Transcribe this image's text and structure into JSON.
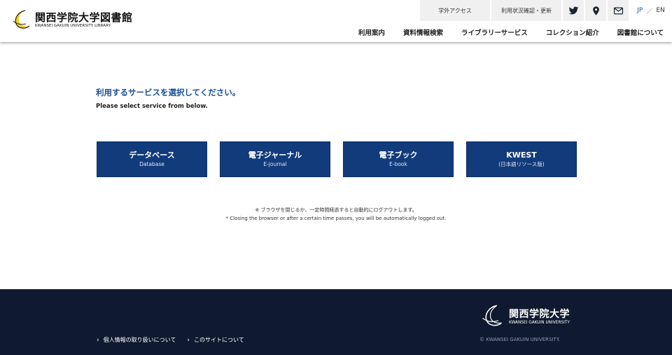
{
  "header": {
    "logo_jp": "関西学院大学図書館",
    "logo_en": "KWANSEI GAKUIN UNIVERSITY LIBRARY",
    "util": {
      "access_label": "学外アクセス",
      "status_label": "利用状況確認・更新",
      "icons": [
        "twitter-icon",
        "map-pin-icon",
        "mail-icon"
      ]
    },
    "lang": {
      "jp": "JP",
      "sep": "／",
      "en": "EN"
    },
    "nav": [
      {
        "label": "利用案内"
      },
      {
        "label": "資料情報検索"
      },
      {
        "label": "ライブラリーサービス"
      },
      {
        "label": "コレクション紹介"
      },
      {
        "label": "図書館について"
      }
    ]
  },
  "main": {
    "heading_jp": "利用するサービスを選択してください。",
    "heading_en": "Please select service from below.",
    "services": [
      {
        "title": "データベース",
        "sub": "Database"
      },
      {
        "title": "電子ジャーナル",
        "sub": "E-journal"
      },
      {
        "title": "電子ブック",
        "sub": "E-book"
      },
      {
        "title": "KWEST",
        "sub": "(日本語リソース版)"
      }
    ],
    "notice_jp": "※ ブラウザを閉じるか、一定時間経過すると自動的にログアウトします。",
    "notice_en": "* Closing the browser or after a certain time passes, you will be automatically logged out."
  },
  "footer": {
    "links": [
      {
        "label": "個人情報の取り扱いについて"
      },
      {
        "label": "このサイトについて"
      }
    ],
    "logo_jp": "関西学院大学",
    "logo_en": "KWANSEI GAKUIN UNIVERSITY",
    "copyright": "© KWANSEI GAKUIN UNIVERSITY."
  },
  "colors": {
    "accent": "#1a4f9a",
    "button": "#123b7c",
    "footer_bg": "#0f1a30",
    "moon": "#f2d21b"
  }
}
